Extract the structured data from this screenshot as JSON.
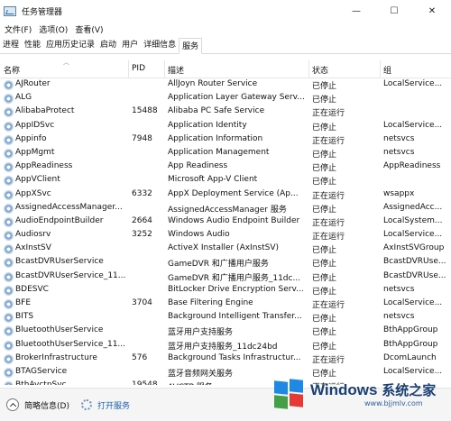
{
  "window": {
    "title": "任务管理器",
    "minimize": "—",
    "maximize": "☐",
    "close": "✕"
  },
  "menu": [
    "文件(F)",
    "选项(O)",
    "查看(V)"
  ],
  "tabs": [
    "进程",
    "性能",
    "应用历史记录",
    "启动",
    "用户",
    "详细信息",
    "服务"
  ],
  "active_tab": "服务",
  "columns": {
    "name": "名称",
    "pid": "PID",
    "desc": "描述",
    "status": "状态",
    "group": "组"
  },
  "services": [
    {
      "name": "AJRouter",
      "pid": "",
      "desc": "AllJoyn Router Service",
      "status": "已停止",
      "group": "LocalService..."
    },
    {
      "name": "ALG",
      "pid": "",
      "desc": "Application Layer Gateway Serv...",
      "status": "已停止",
      "group": ""
    },
    {
      "name": "AlibabaProtect",
      "pid": "15488",
      "desc": "Alibaba PC Safe Service",
      "status": "正在运行",
      "group": ""
    },
    {
      "name": "AppIDSvc",
      "pid": "",
      "desc": "Application Identity",
      "status": "已停止",
      "group": "LocalService..."
    },
    {
      "name": "Appinfo",
      "pid": "7948",
      "desc": "Application Information",
      "status": "正在运行",
      "group": "netsvcs"
    },
    {
      "name": "AppMgmt",
      "pid": "",
      "desc": "Application Management",
      "status": "已停止",
      "group": "netsvcs"
    },
    {
      "name": "AppReadiness",
      "pid": "",
      "desc": "App Readiness",
      "status": "已停止",
      "group": "AppReadiness"
    },
    {
      "name": "AppVClient",
      "pid": "",
      "desc": "Microsoft App-V Client",
      "status": "已停止",
      "group": ""
    },
    {
      "name": "AppXSvc",
      "pid": "6332",
      "desc": "AppX Deployment Service (Ap...",
      "status": "正在运行",
      "group": "wsappx"
    },
    {
      "name": "AssignedAccessManager...",
      "pid": "",
      "desc": "AssignedAccessManager 服务",
      "status": "已停止",
      "group": "AssignedAcc..."
    },
    {
      "name": "AudioEndpointBuilder",
      "pid": "2664",
      "desc": "Windows Audio Endpoint Builder",
      "status": "正在运行",
      "group": "LocalSystem..."
    },
    {
      "name": "Audiosrv",
      "pid": "3252",
      "desc": "Windows Audio",
      "status": "正在运行",
      "group": "LocalService..."
    },
    {
      "name": "AxInstSV",
      "pid": "",
      "desc": "ActiveX Installer (AxInstSV)",
      "status": "已停止",
      "group": "AxInstSVGroup"
    },
    {
      "name": "BcastDVRUserService",
      "pid": "",
      "desc": "GameDVR 和广播用户服务",
      "status": "已停止",
      "group": "BcastDVRUse..."
    },
    {
      "name": "BcastDVRUserService_11...",
      "pid": "",
      "desc": "GameDVR 和广播用户服务_11dc...",
      "status": "已停止",
      "group": "BcastDVRUse..."
    },
    {
      "name": "BDESVC",
      "pid": "",
      "desc": "BitLocker Drive Encryption Serv...",
      "status": "已停止",
      "group": "netsvcs"
    },
    {
      "name": "BFE",
      "pid": "3704",
      "desc": "Base Filtering Engine",
      "status": "正在运行",
      "group": "LocalService..."
    },
    {
      "name": "BITS",
      "pid": "",
      "desc": "Background Intelligent Transfer...",
      "status": "已停止",
      "group": "netsvcs"
    },
    {
      "name": "BluetoothUserService",
      "pid": "",
      "desc": "蓝牙用户支持服务",
      "status": "已停止",
      "group": "BthAppGroup"
    },
    {
      "name": "BluetoothUserService_11...",
      "pid": "",
      "desc": "蓝牙用户支持服务_11dc24bd",
      "status": "已停止",
      "group": "BthAppGroup"
    },
    {
      "name": "BrokerInfrastructure",
      "pid": "576",
      "desc": "Background Tasks Infrastructur...",
      "status": "正在运行",
      "group": "DcomLaunch"
    },
    {
      "name": "BTAGService",
      "pid": "",
      "desc": "蓝牙音频网关服务",
      "status": "已停止",
      "group": "LocalService..."
    },
    {
      "name": "BthAvctpSvc",
      "pid": "19548",
      "desc": "AVCTP 服务",
      "status": "正在运行",
      "group": ""
    }
  ],
  "footer": {
    "brief": "简略信息(D)",
    "open_services": "打开服务"
  },
  "watermark": {
    "brand": "Windows",
    "cn": "系统之家",
    "url": "www.bjjmlv.com"
  }
}
